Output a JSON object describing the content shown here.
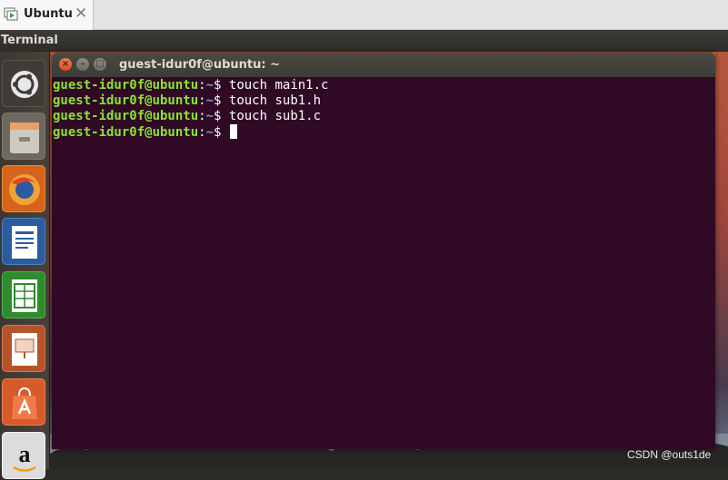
{
  "vm_tab": {
    "label": "Ubuntu",
    "close_glyph": "✕",
    "icon": "vm-play-icon"
  },
  "top_panel": {
    "app_name": "Terminal"
  },
  "launcher": {
    "items": [
      {
        "name": "dash-home",
        "icon": "ubuntu-logo-icon"
      },
      {
        "name": "files",
        "icon": "file-cabinet-icon"
      },
      {
        "name": "firefox",
        "icon": "firefox-icon"
      },
      {
        "name": "libreoffice-writer",
        "icon": "writer-document-icon"
      },
      {
        "name": "libreoffice-calc",
        "icon": "calc-spreadsheet-icon"
      },
      {
        "name": "libreoffice-impress",
        "icon": "impress-presentation-icon"
      },
      {
        "name": "ubuntu-software",
        "icon": "shopping-bag-icon"
      },
      {
        "name": "amazon",
        "icon": "amazon-logo-icon"
      }
    ]
  },
  "terminal": {
    "window_title": "guest-idur0f@ubuntu: ~",
    "buttons": {
      "close": "×",
      "minimize": "–",
      "maximize": "□"
    },
    "lines": [
      {
        "user": "guest-idur0f@ubuntu",
        "colon": ":",
        "path": "~",
        "sign": "$",
        "command": " touch main1.c"
      },
      {
        "user": "guest-idur0f@ubuntu",
        "colon": ":",
        "path": "~",
        "sign": "$",
        "command": " touch sub1.h"
      },
      {
        "user": "guest-idur0f@ubuntu",
        "colon": ":",
        "path": "~",
        "sign": "$",
        "command": " touch sub1.c"
      },
      {
        "user": "guest-idur0f@ubuntu",
        "colon": ":",
        "path": "~",
        "sign": "$",
        "command": " "
      }
    ],
    "colors": {
      "background": "#300a24",
      "user": "#8ae234",
      "path": "#729fcf",
      "text": "#ffffff"
    }
  },
  "watermark": "CSDN @outs1de"
}
